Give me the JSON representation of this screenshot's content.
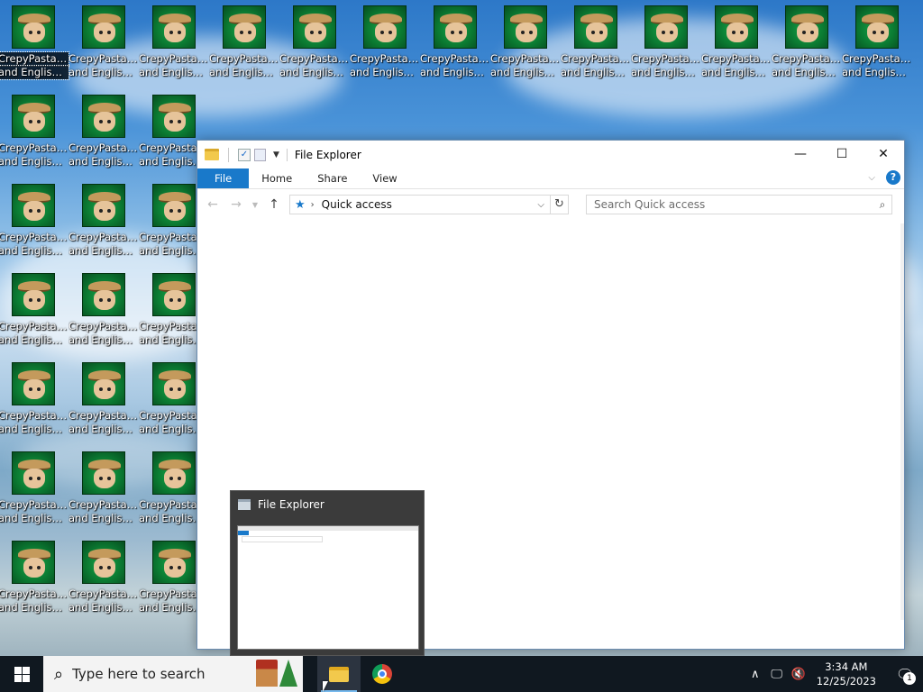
{
  "desktop": {
    "icon_label_line1": "CrepyPasta(...",
    "icon_label_line2": "and English ...",
    "icon_name": "creepypasta-character-icon"
  },
  "explorer": {
    "title": "File Explorer",
    "tabs": [
      "File",
      "Home",
      "Share",
      "View"
    ],
    "address": "Quick access",
    "search_placeholder": "Search Quick access",
    "controls": {
      "minimize": "—",
      "maximize": "☐",
      "close": "✕"
    }
  },
  "preview": {
    "title": "File Explorer"
  },
  "taskbar": {
    "search_placeholder": "Type here to search",
    "time": "3:34 AM",
    "date": "12/25/2023",
    "notification_count": "1"
  },
  "colors": {
    "accent": "#1979ca",
    "taskbar": "#101820"
  }
}
